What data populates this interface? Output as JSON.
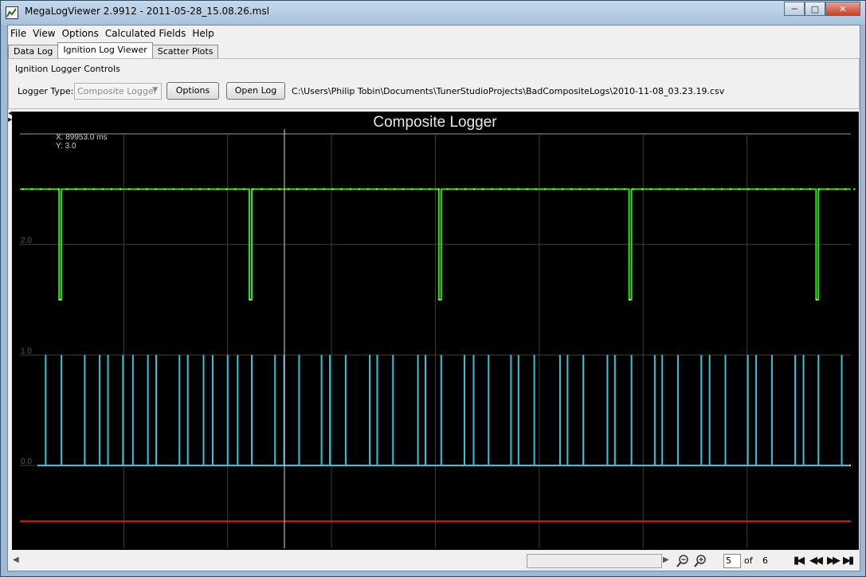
{
  "window": {
    "title": "MegaLogViewer  2.9912 - 2011-05-28_15.08.26.msl",
    "controls": [
      "minimize",
      "maximize",
      "close"
    ]
  },
  "menu": [
    "File",
    "View",
    "Options",
    "Calculated Fields",
    "Help"
  ],
  "tabs": [
    {
      "label": "Data Log",
      "active": false
    },
    {
      "label": "Ignition Log Viewer",
      "active": true
    },
    {
      "label": "Scatter Plots",
      "active": false
    }
  ],
  "controls": {
    "title": "Ignition Logger Controls",
    "logger_type_label": "Logger Type:",
    "logger_type_value": "Composite Logger",
    "options_button": "Options",
    "open_log_button": "Open Log",
    "file_path": "C:\\Users\\Philip Tobin\\Documents\\TunerStudioProjects\\BadCompositeLogs\\2010-11-08_03.23.19.csv"
  },
  "chart_data": {
    "type": "line",
    "title": "Composite Logger",
    "cursor_readout": {
      "x": "X: 89953.0 ms",
      "y": "Y: 3.0"
    },
    "y_ticks": [
      "2.0",
      "1.0",
      "0.0"
    ],
    "ylim": [
      -0.75,
      3.0
    ],
    "grid": true,
    "background": "#000000",
    "series": [
      {
        "color": "#35e010",
        "baseline": 2.5,
        "dip_to": 1.5,
        "dip_positions": [
          0.05,
          0.279,
          0.507,
          0.736,
          0.961
        ]
      },
      {
        "color": "#36c4dc",
        "baseline": 0.0,
        "pulse_to": 1.0,
        "pulse_positions": [
          0.031,
          0.05,
          0.078,
          0.096,
          0.106,
          0.124,
          0.136,
          0.154,
          0.164,
          0.192,
          0.202,
          0.221,
          0.232,
          0.25,
          0.262,
          0.279,
          0.307,
          0.318,
          0.336,
          0.363,
          0.373,
          0.392,
          0.421,
          0.43,
          0.449,
          0.479,
          0.488,
          0.507,
          0.535,
          0.546,
          0.564,
          0.591,
          0.6,
          0.619,
          0.65,
          0.659,
          0.678,
          0.707,
          0.716,
          0.736,
          0.764,
          0.773,
          0.792,
          0.82,
          0.83,
          0.849,
          0.876,
          0.886,
          0.905,
          0.933,
          0.943,
          0.961,
          0.989
        ]
      },
      {
        "color": "#e01010",
        "baseline": -0.75
      }
    ]
  },
  "statusbar": {
    "page_value": "5",
    "of_label": "of",
    "total_pages": "6"
  }
}
